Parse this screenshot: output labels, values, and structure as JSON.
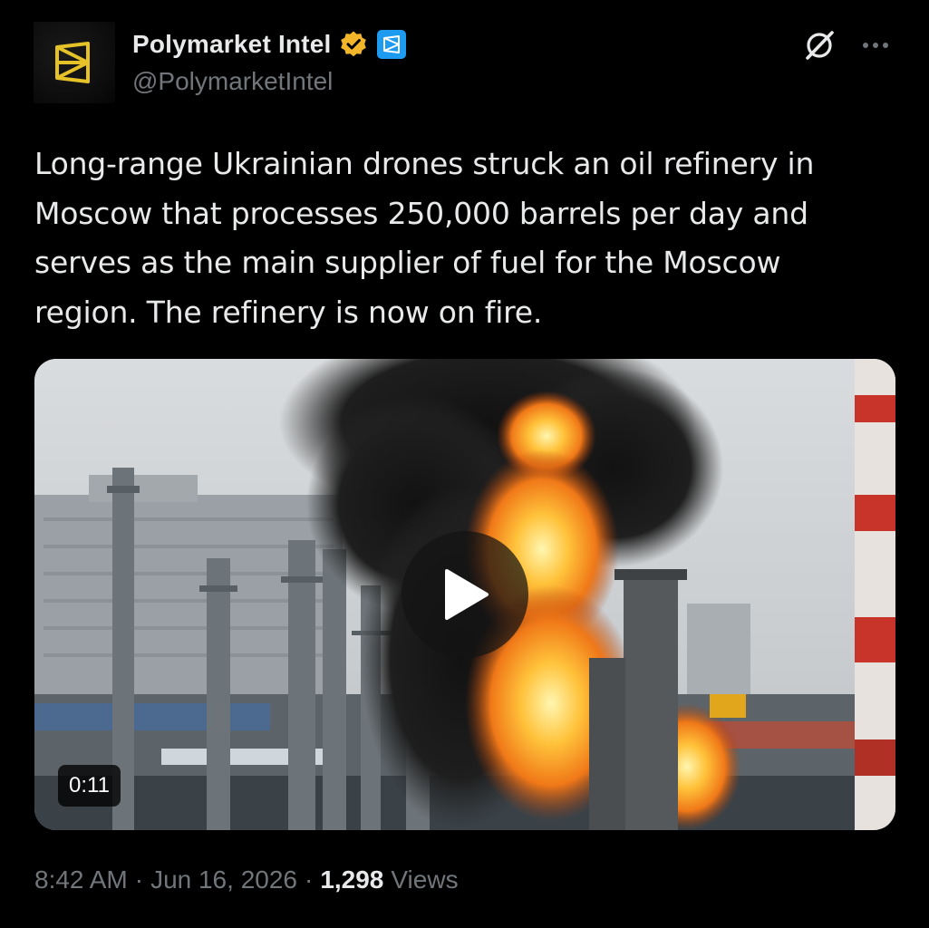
{
  "author": {
    "display_name": "Polymarket Intel",
    "handle": "@PolymarketIntel",
    "verified_badge": "gold-verified-badge-icon",
    "affiliate_badge": "affiliate-logo-icon"
  },
  "header": {
    "grok_icon": "grok-icon",
    "more_icon": "more-options-icon"
  },
  "tweet": {
    "text": "Long-range Ukrainian drones struck an oil refinery in Moscow that processes 250,000 barrels per day and serves as the main supplier of fuel for the Moscow region. The refinery is now on fire."
  },
  "media": {
    "type": "video",
    "duration": "0:11",
    "play_icon": "play-icon"
  },
  "meta": {
    "time": "8:42 AM",
    "separator": "·",
    "date": "Jun 16, 2026",
    "views_count": "1,298",
    "views_label": "Views"
  },
  "colors": {
    "background": "#000000",
    "text_primary": "#e7e9ea",
    "text_secondary": "#71767b",
    "verified_gold": "#f3b62a",
    "affiliate_blue": "#1d9bf0",
    "brand_yellow": "#e6c229"
  }
}
